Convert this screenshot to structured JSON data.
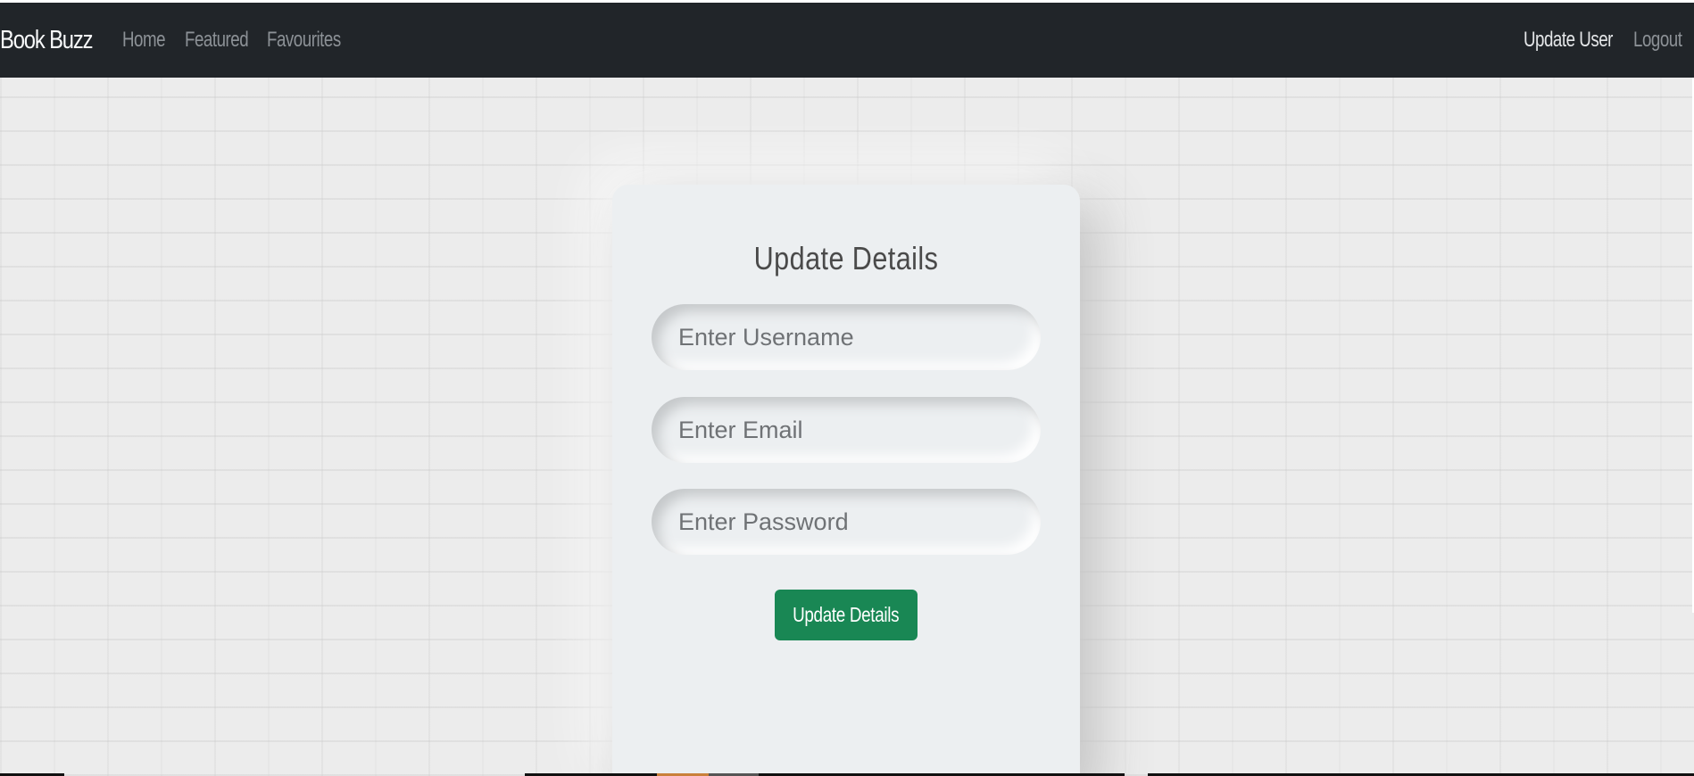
{
  "navbar": {
    "brand": "Book Buzz",
    "links": {
      "home": "Home",
      "featured": "Featured",
      "favourites": "Favourites",
      "update_user": "Update User",
      "logout": "Logout"
    }
  },
  "form": {
    "title": "Update Details",
    "username_placeholder": "Enter Username",
    "email_placeholder": "Enter Email",
    "password_placeholder": "Enter Password",
    "submit_label": "Update Details"
  },
  "colors": {
    "navbar_bg": "#212529",
    "button_bg": "#198754",
    "card_bg": "#eceff1"
  }
}
